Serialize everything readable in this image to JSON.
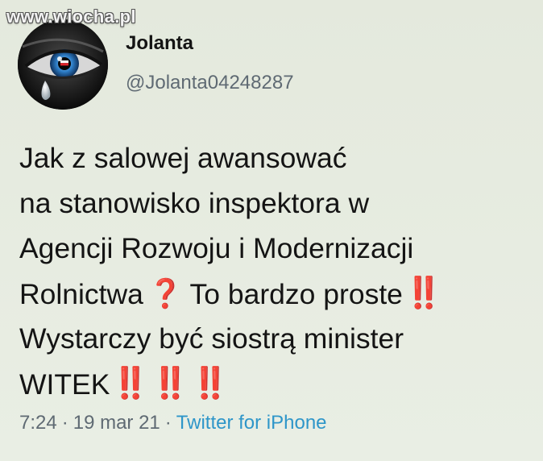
{
  "watermark": "www.wiocha.pl",
  "author": {
    "name": "Jolanta",
    "handle": "@Jolanta04248287"
  },
  "tweet": {
    "line1": "Jak z salowej awansować",
    "line2": "na stanowisko inspektora w",
    "line3": "Agencji Rozwoju i Modernizacji",
    "line4_a": "Rolnictwa",
    "line4_emoji_q": "❓",
    "line4_b": "To bardzo proste",
    "line4_emoji_exc": "‼️",
    "line5": "Wystarczy być siostrą minister",
    "line6": "WITEK",
    "line6_emoji_1": "‼️",
    "line6_emoji_2": "‼️",
    "line6_emoji_3": "‼️"
  },
  "meta": {
    "time": "7:24",
    "separator": "·",
    "date": "19 mar 21",
    "source": "Twitter for iPhone"
  },
  "colors": {
    "background": "#e6ebdf",
    "text": "#141414",
    "secondary": "#5f6a73",
    "link": "#2e96c9",
    "emoji_red": "#d9261c"
  },
  "icons": {
    "avatar": "crying-eye-avatar"
  }
}
